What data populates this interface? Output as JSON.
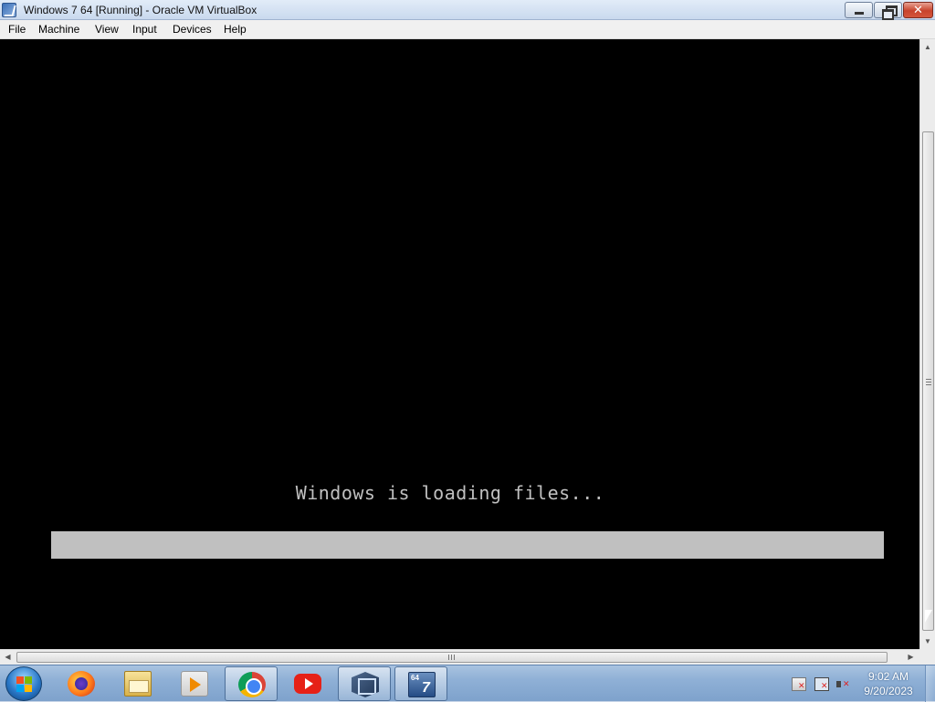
{
  "window": {
    "title": "Windows 7 64 [Running] - Oracle VM VirtualBox"
  },
  "menu": {
    "items": [
      "File",
      "Machine",
      "View",
      "Input",
      "Devices",
      "Help"
    ]
  },
  "vm": {
    "status_text": "Windows is loading files...",
    "progress_fraction": 1.0
  },
  "taskbar": {
    "pinned": [
      {
        "name": "firefox-icon",
        "active": false
      },
      {
        "name": "file-explorer-icon",
        "active": false
      },
      {
        "name": "media-player-icon",
        "active": false
      },
      {
        "name": "chrome-icon",
        "active": true
      },
      {
        "name": "youtube-icon",
        "active": false
      },
      {
        "name": "virtualbox-icon",
        "active": true
      },
      {
        "name": "windows7-vm-icon",
        "active": true
      }
    ],
    "vm_icon_label_top": "64",
    "vm_icon_label_main": "7"
  },
  "tray": {
    "time": "9:02 AM",
    "date": "9/20/2023"
  },
  "colors": {
    "vm_background": "#000000",
    "loading_text": "#c0c0c0",
    "progress_bar": "#c0c0c0",
    "taskbar": "#8fb0d6"
  }
}
